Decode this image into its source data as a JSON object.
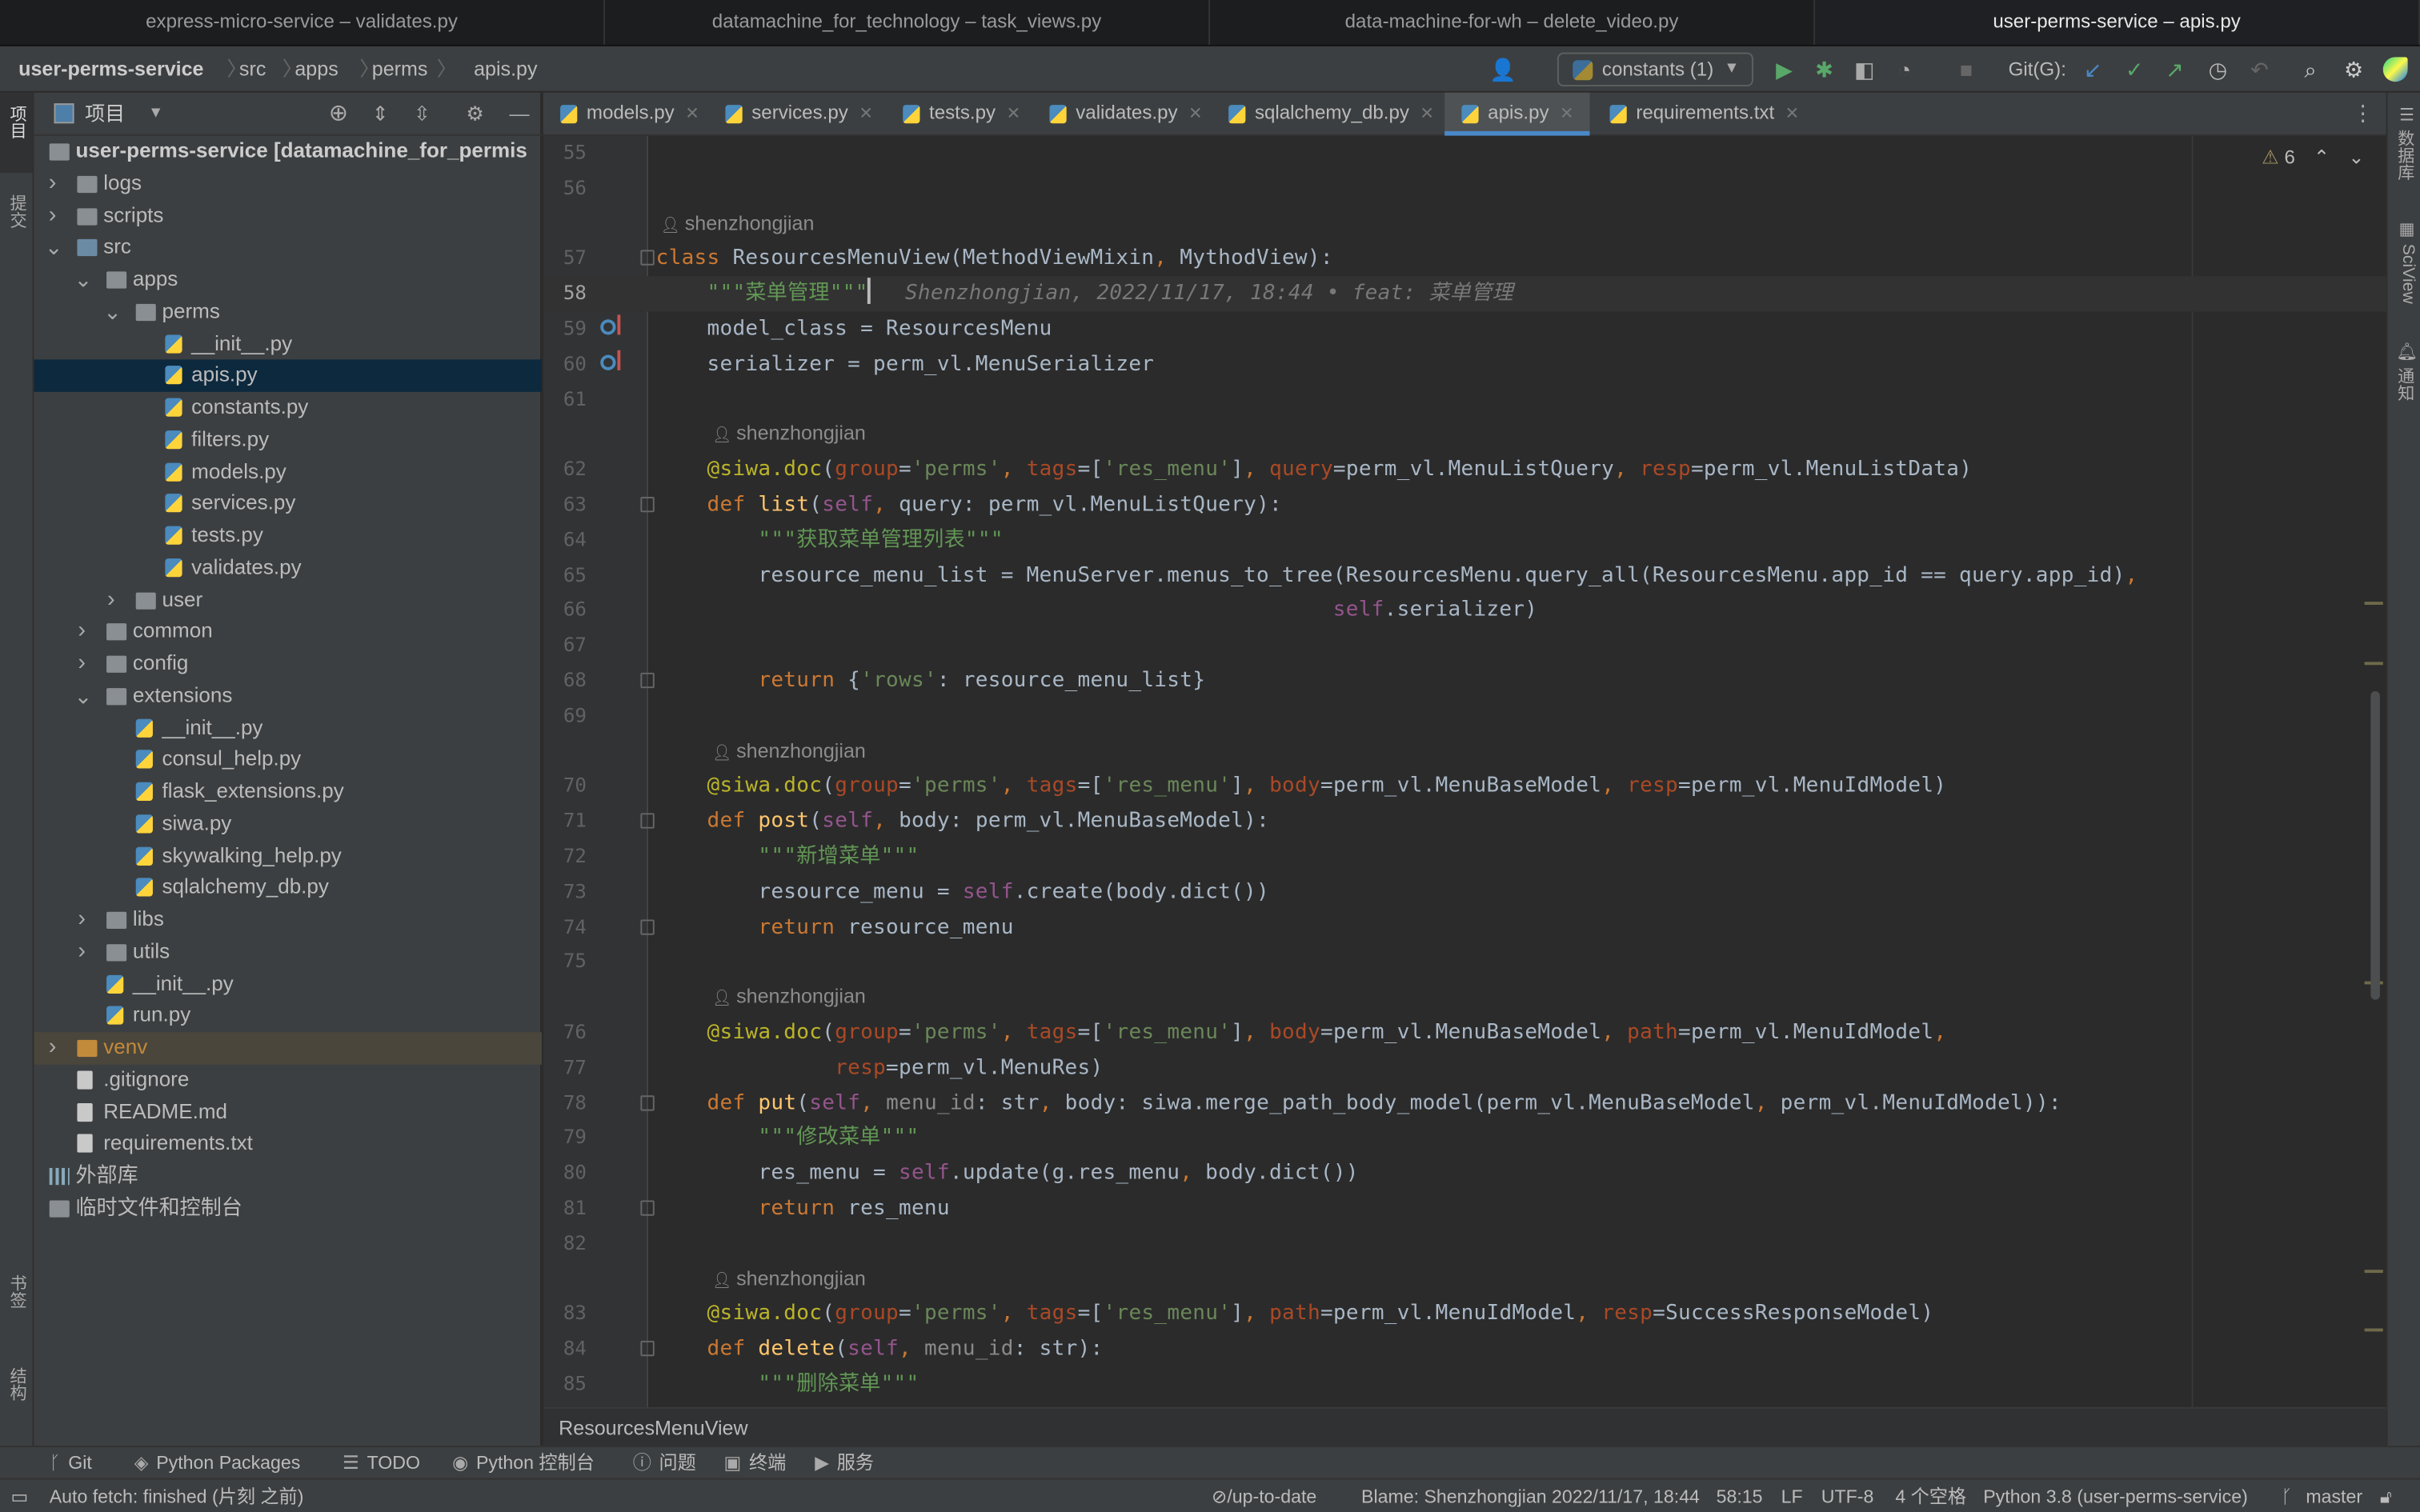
{
  "window_tabs": [
    {
      "label": "express-micro-service – validates.py",
      "active": false
    },
    {
      "label": "datamachine_for_technology – task_views.py",
      "active": false
    },
    {
      "label": "data-machine-for-wh – delete_video.py",
      "active": false
    },
    {
      "label": "user-perms-service – apis.py",
      "active": true
    }
  ],
  "breadcrumb": [
    "user-perms-service",
    "src",
    "apps",
    "perms",
    "apis.py"
  ],
  "toolbar": {
    "run_config": "constants (1)",
    "git_label": "Git(G):",
    "icons": [
      "user-icon",
      "run-icon",
      "debug-icon",
      "coverage-icon",
      "profile-icon",
      "stop-icon",
      "git-update-icon",
      "git-commit-icon",
      "git-push-icon",
      "history-icon",
      "rollback-icon",
      "search-icon",
      "settings-icon",
      "jetbrains-logo"
    ]
  },
  "left_strip": [
    "项目",
    "提交",
    "书签",
    "结构"
  ],
  "right_strip": [
    "数据库",
    "SciView",
    "通知"
  ],
  "project": {
    "title": "项目",
    "tree": [
      {
        "d": 0,
        "k": "root",
        "label": "user-perms-service [datamachine_for_permis",
        "open": true
      },
      {
        "d": 1,
        "k": "folder",
        "label": "logs",
        "open": false
      },
      {
        "d": 1,
        "k": "folder",
        "label": "scripts",
        "open": false
      },
      {
        "d": 1,
        "k": "src",
        "label": "src",
        "open": true
      },
      {
        "d": 2,
        "k": "folder",
        "label": "apps",
        "open": true
      },
      {
        "d": 3,
        "k": "folder",
        "label": "perms",
        "open": true
      },
      {
        "d": 4,
        "k": "py",
        "label": "__init__.py"
      },
      {
        "d": 4,
        "k": "py",
        "label": "apis.py",
        "selected": true
      },
      {
        "d": 4,
        "k": "py",
        "label": "constants.py"
      },
      {
        "d": 4,
        "k": "py",
        "label": "filters.py"
      },
      {
        "d": 4,
        "k": "py",
        "label": "models.py"
      },
      {
        "d": 4,
        "k": "py",
        "label": "services.py"
      },
      {
        "d": 4,
        "k": "py",
        "label": "tests.py"
      },
      {
        "d": 4,
        "k": "py",
        "label": "validates.py"
      },
      {
        "d": 3,
        "k": "folder",
        "label": "user",
        "open": false
      },
      {
        "d": 2,
        "k": "folder",
        "label": "common",
        "open": false
      },
      {
        "d": 2,
        "k": "folder",
        "label": "config",
        "open": false
      },
      {
        "d": 2,
        "k": "folder",
        "label": "extensions",
        "open": true
      },
      {
        "d": 3,
        "k": "py",
        "label": "__init__.py"
      },
      {
        "d": 3,
        "k": "py",
        "label": "consul_help.py"
      },
      {
        "d": 3,
        "k": "py",
        "label": "flask_extensions.py"
      },
      {
        "d": 3,
        "k": "py",
        "label": "siwa.py"
      },
      {
        "d": 3,
        "k": "py",
        "label": "skywalking_help.py"
      },
      {
        "d": 3,
        "k": "py",
        "label": "sqlalchemy_db.py"
      },
      {
        "d": 2,
        "k": "folder",
        "label": "libs",
        "open": false
      },
      {
        "d": 2,
        "k": "folder",
        "label": "utils",
        "open": false
      },
      {
        "d": 2,
        "k": "py",
        "label": "__init__.py"
      },
      {
        "d": 2,
        "k": "py",
        "label": "run.py"
      },
      {
        "d": 1,
        "k": "venv",
        "label": "venv",
        "open": false
      },
      {
        "d": 1,
        "k": "txt",
        "label": ".gitignore"
      },
      {
        "d": 1,
        "k": "txt",
        "label": "README.md"
      },
      {
        "d": 1,
        "k": "txt",
        "label": "requirements.txt"
      },
      {
        "d": 0,
        "k": "lib",
        "label": "外部库"
      },
      {
        "d": 0,
        "k": "scratch",
        "label": "临时文件和控制台"
      }
    ]
  },
  "editor_tabs": [
    {
      "label": "models.py"
    },
    {
      "label": "services.py"
    },
    {
      "label": "tests.py"
    },
    {
      "label": "validates.py"
    },
    {
      "label": "sqlalchemy_db.py"
    },
    {
      "label": "apis.py",
      "active": true
    },
    {
      "label": "requirements.txt"
    }
  ],
  "editor": {
    "warnings": "6",
    "lines": [
      {
        "n": "55",
        "t": []
      },
      {
        "n": "56",
        "t": []
      },
      {
        "author": "shenzhongjian",
        "ind": 0
      },
      {
        "n": "57",
        "fold": true,
        "t": [
          [
            "kw",
            "class "
          ],
          [
            "def",
            "ResourcesMenuView(MethodViewMixin"
          ],
          [
            "kw",
            ", "
          ],
          [
            "def",
            "MythodView):"
          ]
        ]
      },
      {
        "n": "58",
        "current": true,
        "blame": "Shenzhongjian, 2022/11/17, 18:44 • feat: 菜单管理",
        "t": [
          [
            "def",
            "    "
          ],
          [
            "doc",
            "\"\"\"菜单管理\"\"\""
          ]
        ]
      },
      {
        "n": "59",
        "mark": true,
        "t": [
          [
            "def",
            "    model_class = ResourcesMenu"
          ]
        ]
      },
      {
        "n": "60",
        "mark": true,
        "t": [
          [
            "def",
            "    serializer = perm_vl.MenuSerializer"
          ]
        ]
      },
      {
        "n": "61",
        "t": []
      },
      {
        "author": "shenzhongjian",
        "ind": 4
      },
      {
        "n": "62",
        "t": [
          [
            "dec",
            "    @siwa.doc"
          ],
          [
            "def",
            "("
          ],
          [
            "arg",
            "group"
          ],
          [
            "def",
            "="
          ],
          [
            "str",
            "'perms'"
          ],
          [
            "kw",
            ", "
          ],
          [
            "arg",
            "tags"
          ],
          [
            "def",
            "=["
          ],
          [
            "str",
            "'res_menu'"
          ],
          [
            "def",
            "]"
          ],
          [
            "kw",
            ", "
          ],
          [
            "arg",
            "query"
          ],
          [
            "def",
            "=perm_vl.MenuListQuery"
          ],
          [
            "kw",
            ", "
          ],
          [
            "arg",
            "resp"
          ],
          [
            "def",
            "=perm_vl.MenuListData)"
          ]
        ]
      },
      {
        "n": "63",
        "fold": true,
        "t": [
          [
            "kw",
            "    def "
          ],
          [
            "fn",
            "list"
          ],
          [
            "def",
            "("
          ],
          [
            "self",
            "self"
          ],
          [
            "kw",
            ", "
          ],
          [
            "def",
            "query: perm_vl.MenuListQuery):"
          ]
        ]
      },
      {
        "n": "64",
        "t": [
          [
            "def",
            "        "
          ],
          [
            "doc",
            "\"\"\"获取菜单管理列表\"\"\""
          ]
        ]
      },
      {
        "n": "65",
        "t": [
          [
            "def",
            "        resource_menu_list = MenuServer.menus_to_tree(ResourcesMenu.query_all(ResourcesMenu.app_id == query.app_id)"
          ],
          [
            "kw",
            ","
          ]
        ]
      },
      {
        "n": "66",
        "t": [
          [
            "def",
            "                                                     "
          ],
          [
            "self",
            "self"
          ],
          [
            "def",
            ".serializer)"
          ]
        ]
      },
      {
        "n": "67",
        "t": []
      },
      {
        "n": "68",
        "fold": true,
        "t": [
          [
            "kw",
            "        return "
          ],
          [
            "def",
            "{"
          ],
          [
            "str",
            "'rows'"
          ],
          [
            "def",
            ": resource_menu_list}"
          ]
        ]
      },
      {
        "n": "69",
        "t": []
      },
      {
        "author": "shenzhongjian",
        "ind": 4
      },
      {
        "n": "70",
        "t": [
          [
            "dec",
            "    @siwa.doc"
          ],
          [
            "def",
            "("
          ],
          [
            "arg",
            "group"
          ],
          [
            "def",
            "="
          ],
          [
            "str",
            "'perms'"
          ],
          [
            "kw",
            ", "
          ],
          [
            "arg",
            "tags"
          ],
          [
            "def",
            "=["
          ],
          [
            "str",
            "'res_menu'"
          ],
          [
            "def",
            "]"
          ],
          [
            "kw",
            ", "
          ],
          [
            "arg",
            "body"
          ],
          [
            "def",
            "=perm_vl.MenuBaseModel"
          ],
          [
            "kw",
            ", "
          ],
          [
            "arg",
            "resp"
          ],
          [
            "def",
            "=perm_vl.MenuIdModel)"
          ]
        ]
      },
      {
        "n": "71",
        "fold": true,
        "t": [
          [
            "kw",
            "    def "
          ],
          [
            "fn",
            "post"
          ],
          [
            "def",
            "("
          ],
          [
            "self",
            "self"
          ],
          [
            "kw",
            ", "
          ],
          [
            "def",
            "body: perm_vl.MenuBaseModel):"
          ]
        ]
      },
      {
        "n": "72",
        "t": [
          [
            "def",
            "        "
          ],
          [
            "doc",
            "\"\"\"新增菜单\"\"\""
          ]
        ]
      },
      {
        "n": "73",
        "t": [
          [
            "def",
            "        resource_menu = "
          ],
          [
            "self",
            "self"
          ],
          [
            "def",
            ".create(body.dict())"
          ]
        ]
      },
      {
        "n": "74",
        "fold": true,
        "t": [
          [
            "kw",
            "        return "
          ],
          [
            "def",
            "resource_menu"
          ]
        ]
      },
      {
        "n": "75",
        "t": []
      },
      {
        "author": "shenzhongjian",
        "ind": 4
      },
      {
        "n": "76",
        "t": [
          [
            "dec",
            "    @siwa.doc"
          ],
          [
            "def",
            "("
          ],
          [
            "arg",
            "group"
          ],
          [
            "def",
            "="
          ],
          [
            "str",
            "'perms'"
          ],
          [
            "kw",
            ", "
          ],
          [
            "arg",
            "tags"
          ],
          [
            "def",
            "=["
          ],
          [
            "str",
            "'res_menu'"
          ],
          [
            "def",
            "]"
          ],
          [
            "kw",
            ", "
          ],
          [
            "arg",
            "body"
          ],
          [
            "def",
            "=perm_vl.MenuBaseModel"
          ],
          [
            "kw",
            ", "
          ],
          [
            "arg",
            "path"
          ],
          [
            "def",
            "=perm_vl.MenuIdModel"
          ],
          [
            "kw",
            ","
          ]
        ]
      },
      {
        "n": "77",
        "t": [
          [
            "def",
            "              "
          ],
          [
            "arg",
            "resp"
          ],
          [
            "def",
            "=perm_vl.MenuRes)"
          ]
        ]
      },
      {
        "n": "78",
        "fold": true,
        "t": [
          [
            "kw",
            "    def "
          ],
          [
            "fn",
            "put"
          ],
          [
            "def",
            "("
          ],
          [
            "self",
            "self"
          ],
          [
            "kw",
            ", "
          ],
          [
            "unused",
            "menu_id"
          ],
          [
            "def",
            ": str"
          ],
          [
            "kw",
            ", "
          ],
          [
            "def",
            "body: siwa.merge_path_body_model(perm_vl.MenuBaseModel"
          ],
          [
            "kw",
            ", "
          ],
          [
            "def",
            "perm_vl.MenuIdModel)):"
          ]
        ]
      },
      {
        "n": "79",
        "t": [
          [
            "def",
            "        "
          ],
          [
            "doc",
            "\"\"\"修改菜单\"\"\""
          ]
        ]
      },
      {
        "n": "80",
        "t": [
          [
            "def",
            "        res_menu = "
          ],
          [
            "self",
            "self"
          ],
          [
            "def",
            ".update(g.res_menu"
          ],
          [
            "kw",
            ", "
          ],
          [
            "def",
            "body.dict())"
          ]
        ]
      },
      {
        "n": "81",
        "fold": true,
        "t": [
          [
            "kw",
            "        return "
          ],
          [
            "def",
            "res_menu"
          ]
        ]
      },
      {
        "n": "82",
        "t": []
      },
      {
        "author": "shenzhongjian",
        "ind": 4
      },
      {
        "n": "83",
        "t": [
          [
            "dec",
            "    @siwa.doc"
          ],
          [
            "def",
            "("
          ],
          [
            "arg",
            "group"
          ],
          [
            "def",
            "="
          ],
          [
            "str",
            "'perms'"
          ],
          [
            "kw",
            ", "
          ],
          [
            "arg",
            "tags"
          ],
          [
            "def",
            "=["
          ],
          [
            "str",
            "'res_menu'"
          ],
          [
            "def",
            "]"
          ],
          [
            "kw",
            ", "
          ],
          [
            "arg",
            "path"
          ],
          [
            "def",
            "=perm_vl.MenuIdModel"
          ],
          [
            "kw",
            ", "
          ],
          [
            "arg",
            "resp"
          ],
          [
            "def",
            "=SuccessResponseModel)"
          ]
        ]
      },
      {
        "n": "84",
        "fold": true,
        "t": [
          [
            "kw",
            "    def "
          ],
          [
            "fn",
            "delete"
          ],
          [
            "def",
            "("
          ],
          [
            "self",
            "self"
          ],
          [
            "kw",
            ", "
          ],
          [
            "unused",
            "menu_id"
          ],
          [
            "def",
            ": str):"
          ]
        ]
      },
      {
        "n": "85",
        "t": [
          [
            "def",
            "        "
          ],
          [
            "doc",
            "\"\"\"删除菜单\"\"\""
          ]
        ]
      }
    ],
    "breadcrumb": "ResourcesMenuView"
  },
  "tool_windows": [
    "Git",
    "Python Packages",
    "TODO",
    "Python 控制台",
    "问题",
    "终端",
    "服务"
  ],
  "status": {
    "left": "Auto fetch: finished (片刻 之前)",
    "vcs": "⊘/up-to-date",
    "blame": "Blame: Shenzhongjian 2022/11/17, 18:44",
    "position": "58:15",
    "line_sep": "LF",
    "encoding": "UTF-8",
    "indent": "4 个空格",
    "interpreter": "Python 3.8 (user-perms-service)",
    "branch": "master"
  },
  "colors": {
    "accent": "#4a88c7",
    "selection": "#0d293e",
    "keyword": "#cc7832",
    "string": "#6a8759",
    "decorator": "#bbb529"
  }
}
